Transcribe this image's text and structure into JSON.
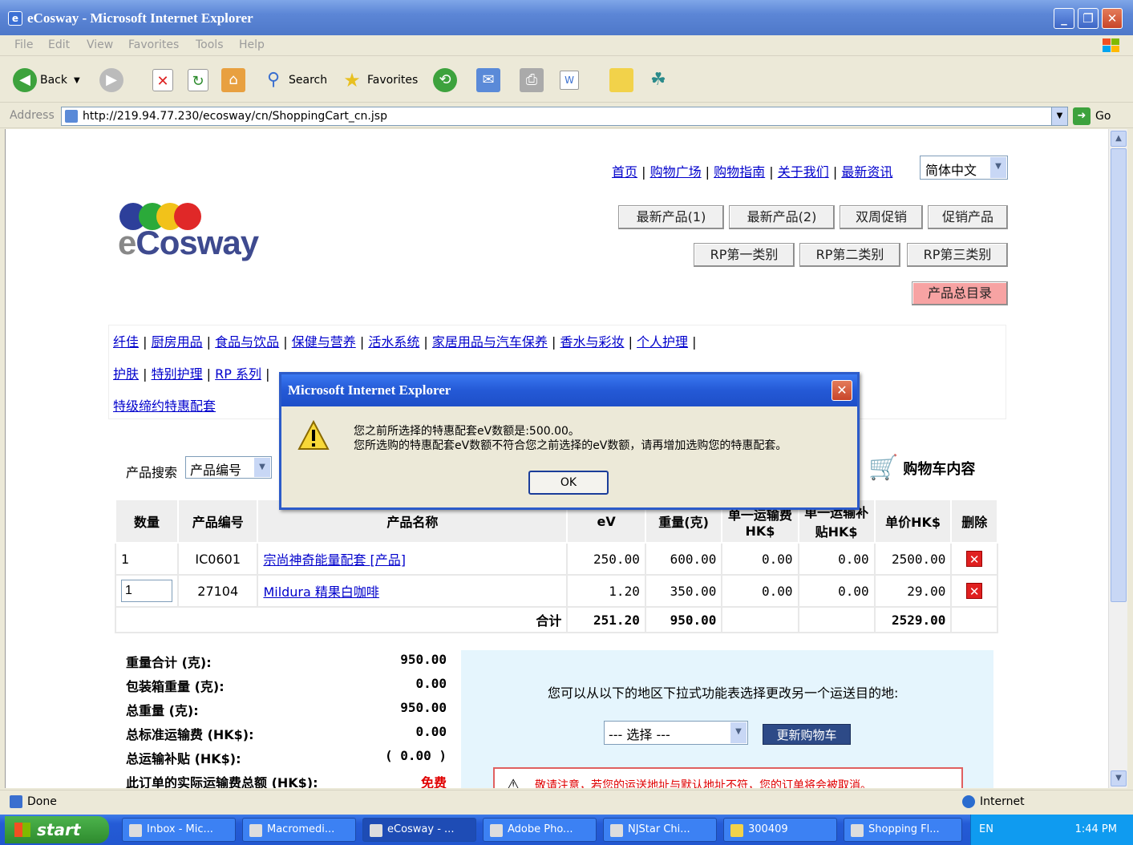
{
  "window": {
    "title": "eCosway - Microsoft Internet Explorer",
    "minimize": "_",
    "restore": "❐",
    "close": "✕"
  },
  "menu": [
    "File",
    "Edit",
    "View",
    "Favorites",
    "Tools",
    "Help"
  ],
  "toolbar": {
    "back": "Back",
    "search": "Search",
    "favorites": "Favorites"
  },
  "address": {
    "label": "Address",
    "url": "http://219.94.77.230/ecosway/cn/ShoppingCart_cn.jsp",
    "go": "Go"
  },
  "page": {
    "toplinks": [
      "首页",
      "购物广场",
      "购物指南",
      "关于我们",
      "最新资讯"
    ],
    "language": "简体中文",
    "logo_text_e": "e",
    "logo_text": "Cosway",
    "category_buttons_row1": [
      "最新产品(1)",
      "最新产品(2)",
      "双周促销",
      "促销产品"
    ],
    "category_buttons_row2": [
      "RP第一类别",
      "RP第二类别",
      "RP第三类别"
    ],
    "catalog_button": "产品总目录",
    "category_links_line1": [
      "纤佳",
      "厨房用品",
      "食品与饮品",
      "保健与营养",
      "活水系统",
      "家居用品与汽车保养",
      "香水与彩妆",
      "个人护理"
    ],
    "category_links_line2": [
      "护肤",
      "特别护理",
      "RP 系列"
    ],
    "category_links_line3": [
      "特级缔约特惠配套"
    ],
    "search_label": "产品搜索",
    "search_type": "产品编号",
    "cart_title": "购物车内容"
  },
  "cart": {
    "headers": [
      "数量",
      "产品编号",
      "产品名称",
      "eV",
      "重量(克)",
      "单一运输费HK$",
      "单一运输补贴HK$",
      "单价HK$",
      "删除"
    ],
    "rows": [
      {
        "qty": "1",
        "code": "IC0601",
        "name": "宗尚神奇能量配套 [产品]",
        "ev": "250.00",
        "weight": "600.00",
        "ship": "0.00",
        "subsidy": "0.00",
        "price": "2500.00"
      },
      {
        "qty": "1",
        "code": "27104",
        "name": "Mildura 精果白咖啡",
        "ev": "1.20",
        "weight": "350.00",
        "ship": "0.00",
        "subsidy": "0.00",
        "price": "29.00"
      }
    ],
    "total_label": "合计",
    "total_ev": "251.20",
    "total_weight": "950.00",
    "total_price": "2529.00"
  },
  "summary": [
    {
      "label": "重量合计 (克):",
      "value": "950.00"
    },
    {
      "label": "包装箱重量 (克):",
      "value": "0.00"
    },
    {
      "label": "总重量 (克):",
      "value": "950.00"
    },
    {
      "label": "总标准运输费 (HK$):",
      "value": "0.00"
    },
    {
      "label": "总运输补贴 (HK$):",
      "value": "( 0.00 )"
    },
    {
      "label": "此订单的实际运输费总额 (HK$):",
      "value": "免费"
    }
  ],
  "shipping": {
    "message": "您可以从以下的地区下拉式功能表选择更改另一个运送目的地:",
    "select_placeholder": "--- 选择 ---",
    "update_button": "更新购物车",
    "warning": "敬请注意，若您的运送地址与默认地址不符，您的订单将会被取消。"
  },
  "dialog": {
    "title": "Microsoft Internet Explorer",
    "line1": "您之前所选择的特惠配套eV数额是:500.00。",
    "line2": "您所选购的特惠配套eV数额不符合您之前选择的eV数额，请再增加选购您的特惠配套。",
    "ok": "OK"
  },
  "status": {
    "text": "Done",
    "zone": "Internet"
  },
  "taskbar": {
    "start": "start",
    "tasks": [
      "Inbox - Mic...",
      "Macromedi...",
      "eCosway - ...",
      "Adobe Pho...",
      "NJStar Chi...",
      "300409",
      "Shopping Fl..."
    ],
    "lang": "EN",
    "time": "1:44 PM"
  },
  "colors": {
    "ie_blue": "#2459D6",
    "link": "#0000CC",
    "delete_red": "#E02020",
    "free_red": "#E00000"
  }
}
